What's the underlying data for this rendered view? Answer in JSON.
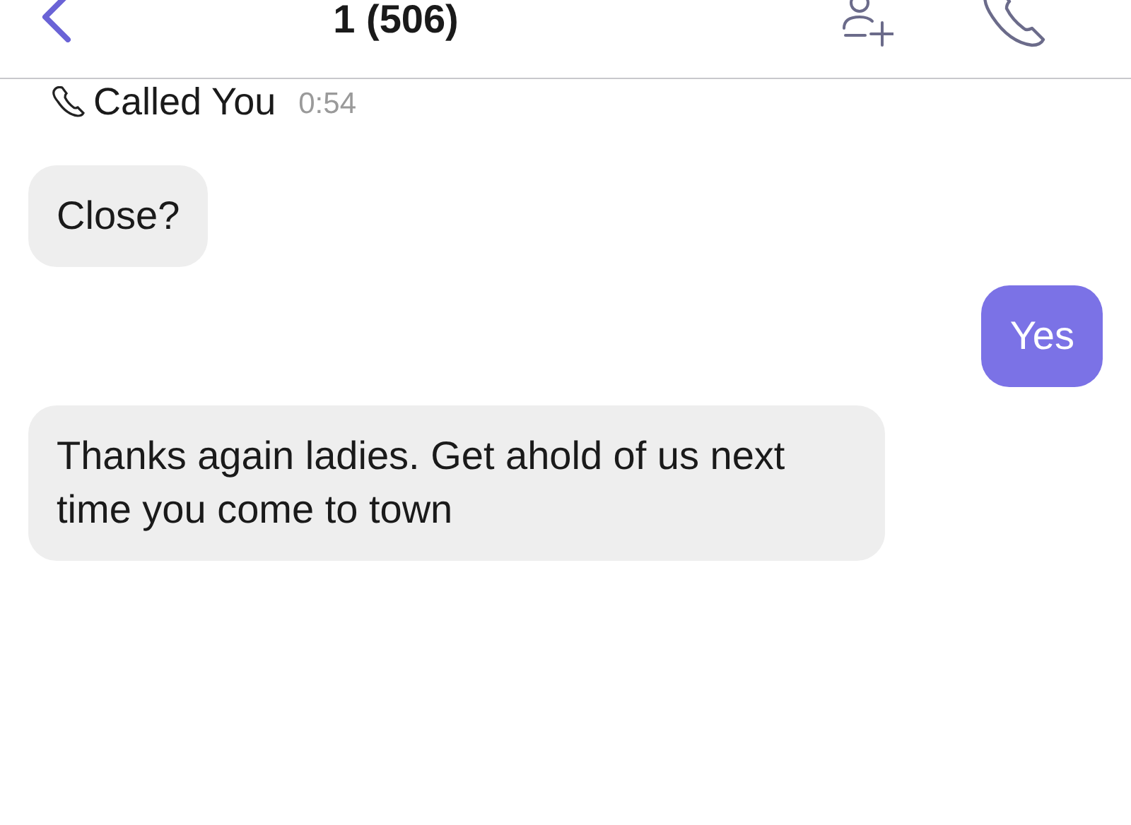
{
  "header": {
    "title": "1 (506)"
  },
  "call_log": {
    "label": "Called You",
    "duration": "0:54"
  },
  "messages": [
    {
      "kind": "incoming",
      "text": "Close?"
    },
    {
      "kind": "outgoing",
      "text": "Yes"
    },
    {
      "kind": "incoming",
      "text": "Thanks again ladies. Get ahold of us next time you come to town"
    }
  ]
}
